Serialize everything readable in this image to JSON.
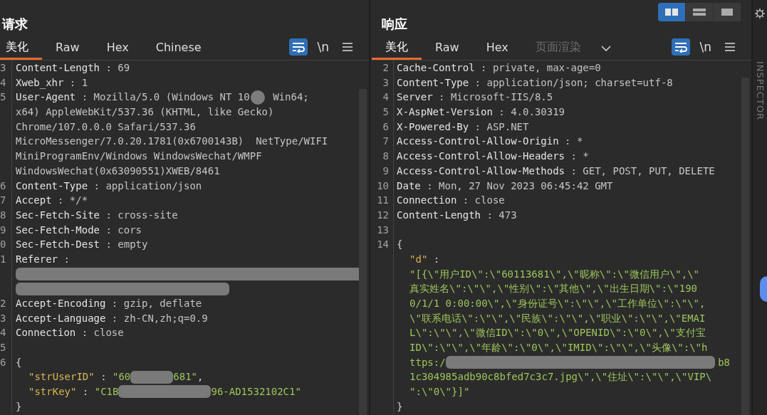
{
  "request": {
    "title": "请求",
    "tabs": [
      {
        "label": "美化",
        "selected": true,
        "disabled": false
      },
      {
        "label": "Raw",
        "selected": false,
        "disabled": false
      },
      {
        "label": "Hex",
        "selected": false,
        "disabled": false
      },
      {
        "label": "Chinese",
        "selected": false,
        "disabled": false
      }
    ],
    "tools": [
      {
        "kind": "wrap",
        "on": true
      },
      {
        "kind": "text",
        "label": "\\n"
      },
      {
        "kind": "menu"
      }
    ],
    "lines": [
      {
        "no": "3",
        "segs": [
          {
            "kind": "name",
            "text": "Content-Length"
          },
          {
            "kind": "value",
            "text": " : 69"
          }
        ]
      },
      {
        "no": "4",
        "segs": [
          {
            "kind": "name",
            "text": "Xweb_xhr"
          },
          {
            "kind": "value",
            "text": " : 1"
          }
        ]
      },
      {
        "no": "5",
        "segs": [
          {
            "kind": "name",
            "text": "User-Agent"
          },
          {
            "kind": "value",
            "text": " : Mozilla/5.0 (Windows NT 10"
          },
          {
            "kind": "cursor"
          },
          {
            "kind": "value",
            "text": " Win64;"
          }
        ]
      },
      {
        "segs": [
          {
            "kind": "value",
            "text": "x64) AppleWebKit/537.36 (KHTML, like Gecko)"
          }
        ]
      },
      {
        "segs": [
          {
            "kind": "value",
            "text": "Chrome/107.0.0.0 Safari/537.36"
          }
        ]
      },
      {
        "segs": [
          {
            "kind": "value",
            "text": "MicroMessenger/7.0.20.1781(0x6700143B)  NetType/WIFI"
          }
        ]
      },
      {
        "segs": [
          {
            "kind": "value",
            "text": "MiniProgramEnv/Windows WindowsWechat/WMPF"
          }
        ]
      },
      {
        "segs": [
          {
            "kind": "value",
            "text": "WindowsWechat(0x63090551)XWEB/8461"
          }
        ]
      },
      {
        "no": "6",
        "segs": [
          {
            "kind": "name",
            "text": "Content-Type"
          },
          {
            "kind": "value",
            "text": " : application/json"
          }
        ]
      },
      {
        "no": "7",
        "segs": [
          {
            "kind": "name",
            "text": "Accept"
          },
          {
            "kind": "value",
            "text": " : */*"
          }
        ]
      },
      {
        "no": "8",
        "segs": [
          {
            "kind": "name",
            "text": "Sec-Fetch-Site"
          },
          {
            "kind": "value",
            "text": " : cross-site"
          }
        ]
      },
      {
        "no": "9",
        "segs": [
          {
            "kind": "name",
            "text": "Sec-Fetch-Mode"
          },
          {
            "kind": "value",
            "text": " : cors"
          }
        ]
      },
      {
        "no": "0",
        "segs": [
          {
            "kind": "name",
            "text": "Sec-Fetch-Dest"
          },
          {
            "kind": "value",
            "text": " : empty"
          }
        ]
      },
      {
        "no": "1",
        "segs": [
          {
            "kind": "name",
            "text": "Referer"
          },
          {
            "kind": "value",
            "text": " :"
          }
        ]
      },
      {
        "segs": [
          {
            "kind": "redacted_line"
          }
        ]
      },
      {
        "segs": [
          {
            "kind": "redacted"
          }
        ]
      },
      {
        "no": "2",
        "segs": [
          {
            "kind": "name",
            "text": "Accept-Encoding"
          },
          {
            "kind": "value",
            "text": " : gzip, deflate"
          }
        ]
      },
      {
        "no": "3",
        "segs": [
          {
            "kind": "name",
            "text": "Accept-Language"
          },
          {
            "kind": "value",
            "text": " : zh-CN,zh;q=0.9"
          }
        ]
      },
      {
        "no": "4",
        "segs": [
          {
            "kind": "name",
            "text": "Connection"
          },
          {
            "kind": "value",
            "text": " : close"
          }
        ]
      },
      {
        "no": "5"
      },
      {
        "no": "6",
        "segs": [
          {
            "kind": "punct",
            "text": "{"
          }
        ]
      },
      {
        "indent": true,
        "segs": [
          {
            "kind": "key",
            "text": "\"strUserID\""
          },
          {
            "kind": "punct",
            "text": " : "
          },
          {
            "kind": "string",
            "text": "\"60"
          },
          {
            "kind": "redacted"
          },
          {
            "kind": "string",
            "text": "681\""
          },
          {
            "kind": "punct",
            "text": ","
          }
        ]
      },
      {
        "indent": true,
        "segs": [
          {
            "kind": "key",
            "text": "\"strKey\""
          },
          {
            "kind": "punct",
            "text": " : "
          },
          {
            "kind": "string",
            "text": "\"C1B"
          },
          {
            "kind": "redacted_long"
          },
          {
            "kind": "string",
            "text": "96-AD1532102C1\""
          }
        ]
      },
      {
        "segs": [
          {
            "kind": "punct",
            "text": "}"
          }
        ]
      }
    ]
  },
  "response": {
    "title": "响应",
    "layouts": [
      {
        "kind": "columns",
        "selected": true
      },
      {
        "kind": "rows",
        "selected": false
      },
      {
        "kind": "single",
        "selected": false
      }
    ],
    "tabs": [
      {
        "label": "美化",
        "selected": true,
        "disabled": false
      },
      {
        "label": "Raw",
        "selected": false,
        "disabled": false
      },
      {
        "label": "Hex",
        "selected": false,
        "disabled": false
      },
      {
        "label": "页面渲染",
        "selected": false,
        "disabled": true
      }
    ],
    "tools": [
      {
        "kind": "wrap",
        "on": true
      },
      {
        "kind": "text",
        "label": "\\n"
      },
      {
        "kind": "menu"
      }
    ],
    "lines": [
      {
        "no": "2",
        "segs": [
          {
            "kind": "name",
            "text": "Cache-Control"
          },
          {
            "kind": "value",
            "text": " : private, max-age=0"
          }
        ]
      },
      {
        "no": "3",
        "segs": [
          {
            "kind": "name",
            "text": "Content-Type"
          },
          {
            "kind": "value",
            "text": " : application/json; charset=utf-8"
          }
        ]
      },
      {
        "no": "4",
        "segs": [
          {
            "kind": "name",
            "text": "Server"
          },
          {
            "kind": "value",
            "text": " : Microsoft-IIS/8.5"
          }
        ]
      },
      {
        "no": "5",
        "segs": [
          {
            "kind": "name",
            "text": "X-AspNet-Version"
          },
          {
            "kind": "value",
            "text": " : 4.0.30319"
          }
        ]
      },
      {
        "no": "6",
        "segs": [
          {
            "kind": "name",
            "text": "X-Powered-By"
          },
          {
            "kind": "value",
            "text": " : ASP.NET"
          }
        ]
      },
      {
        "no": "7",
        "segs": [
          {
            "kind": "name",
            "text": "Access-Control-Allow-Origin"
          },
          {
            "kind": "value",
            "text": " : *"
          }
        ]
      },
      {
        "no": "8",
        "segs": [
          {
            "kind": "name",
            "text": "Access-Control-Allow-Headers"
          },
          {
            "kind": "value",
            "text": " : *"
          }
        ]
      },
      {
        "no": "9",
        "segs": [
          {
            "kind": "name",
            "text": "Access-Control-Allow-Methods"
          },
          {
            "kind": "value",
            "text": " : GET, POST, PUT, DELETE"
          }
        ]
      },
      {
        "no": "10",
        "segs": [
          {
            "kind": "name",
            "text": "Date"
          },
          {
            "kind": "value",
            "text": " : Mon, 27 Nov 2023 06:45:42 GMT"
          }
        ]
      },
      {
        "no": "11",
        "segs": [
          {
            "kind": "name",
            "text": "Connection"
          },
          {
            "kind": "value",
            "text": " : close"
          }
        ]
      },
      {
        "no": "12",
        "segs": [
          {
            "kind": "name",
            "text": "Content-Length"
          },
          {
            "kind": "value",
            "text": " : 473"
          }
        ]
      },
      {
        "no": "13"
      },
      {
        "no": "14",
        "segs": [
          {
            "kind": "punct",
            "text": "{"
          }
        ]
      },
      {
        "indent": true,
        "segs": [
          {
            "kind": "key",
            "text": "\"d\""
          },
          {
            "kind": "punct",
            "text": " :"
          }
        ]
      },
      {
        "indent": true,
        "segs": [
          {
            "kind": "string",
            "text": "\"[{\\\"用户ID\\\":\\\"60113681\\\",\\\"昵称\\\":\\\"微信用户\\\",\\\""
          }
        ]
      },
      {
        "indent": true,
        "segs": [
          {
            "kind": "string",
            "text": "真实姓名\\\":\\\"\\\",\\\"性别\\\":\\\"其他\\\",\\\"出生日期\\\":\\\"190"
          }
        ]
      },
      {
        "indent": true,
        "segs": [
          {
            "kind": "string",
            "text": "0/1/1 0:00:00\\\",\\\"身份证号\\\":\\\"\\\",\\\"工作单位\\\":\\\"\\\","
          }
        ]
      },
      {
        "indent": true,
        "segs": [
          {
            "kind": "string",
            "text": "\\\"联系电话\\\":\\\"\\\",\\\"民族\\\":\\\"\\\",\\\"职业\\\":\\\"\\\",\\\"EMAI"
          }
        ]
      },
      {
        "indent": true,
        "segs": [
          {
            "kind": "string",
            "text": "L\\\":\\\"\\\",\\\"微信ID\\\":\\\"0\\\",\\\"OPENID\\\":\\\"0\\\",\\\"支付宝"
          }
        ]
      },
      {
        "indent": true,
        "segs": [
          {
            "kind": "string",
            "text": "ID\\\":\\\"\\\",\\\"年龄\\\":\\\"0\\\",\\\"IMID\\\":\\\"\\\",\\\"头像\\\":\\\"h"
          }
        ]
      },
      {
        "indent": true,
        "segs": [
          {
            "kind": "string",
            "text": "ttps:/"
          },
          {
            "kind": "redacted_line"
          },
          {
            "kind": "string",
            "text": "b8"
          }
        ]
      },
      {
        "indent": true,
        "segs": [
          {
            "kind": "string",
            "text": "1c304985adb90c8bfed7c3c7.jpg\\\",\\\"住址\\\":\\\"\\\",\\\"VIP\\"
          }
        ]
      },
      {
        "indent": true,
        "segs": [
          {
            "kind": "string",
            "text": "\":\\\"0\\\"}]\""
          }
        ]
      },
      {
        "segs": [
          {
            "kind": "punct",
            "text": "}"
          }
        ]
      }
    ]
  },
  "sidebar": {
    "label": "INSPECTOR"
  }
}
